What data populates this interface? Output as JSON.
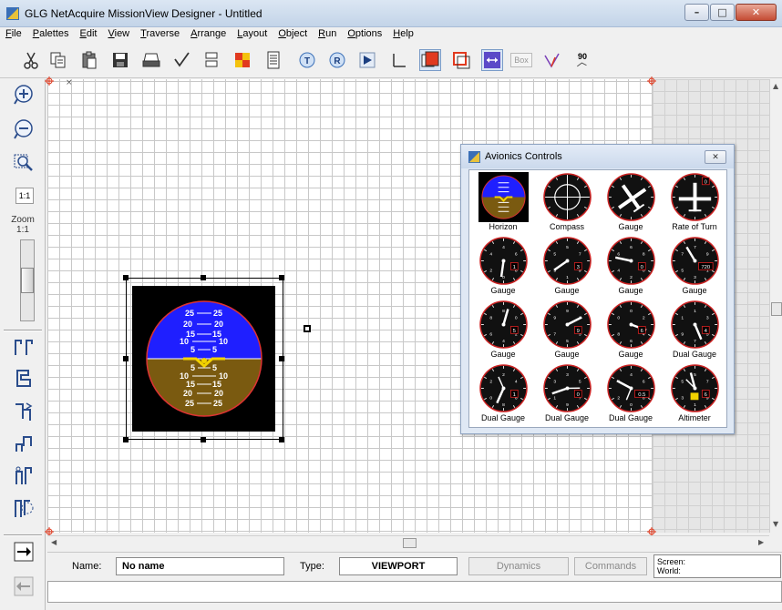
{
  "window": {
    "title": "GLG NetAcquire MissionView Designer - Untitled",
    "minimize": "–",
    "maximize": "□",
    "close": "✕"
  },
  "menu": [
    "File",
    "Palettes",
    "Edit",
    "View",
    "Traverse",
    "Arrange",
    "Layout",
    "Object",
    "Run",
    "Options",
    "Help"
  ],
  "toolbar": {
    "icons": [
      "scissors-icon",
      "copy-icon",
      "paste-icon",
      "save-icon",
      "print-icon",
      "check-arrow-icon",
      "align-icon",
      "color-palette-icon",
      "properties-icon",
      "T-circle-icon",
      "R-circle-icon",
      "play-icon",
      "antialias-icon",
      "fill-color-icon",
      "edge-color-icon",
      "flip-icon",
      "box-icon",
      "rotate-pick-icon",
      "rotate-90-icon"
    ],
    "box_label": "Box",
    "rotate_label": "90"
  },
  "left_palette": {
    "zoom_one_label": "1:1",
    "zoom_label": "Zoom",
    "zoom_value": "1:1"
  },
  "canvas": {
    "horizon_labels_top": [
      "25",
      "25",
      "20",
      "20",
      "15",
      "15",
      "10",
      "10",
      "5",
      "5"
    ],
    "horizon_labels_bottom": [
      "5",
      "5",
      "10",
      "10",
      "15",
      "15",
      "20",
      "20",
      "25",
      "25"
    ]
  },
  "avionics_dialog": {
    "title": "Avionics Controls",
    "close": "✕",
    "items": [
      {
        "label": "Horizon",
        "kind": "horizon"
      },
      {
        "label": "Compass",
        "kind": "compass"
      },
      {
        "label": "Gauge",
        "kind": "plane"
      },
      {
        "label": "Rate of Turn",
        "kind": "turn",
        "readout": "0"
      },
      {
        "label": "Gauge",
        "kind": "dial",
        "readout": "1"
      },
      {
        "label": "Gauge",
        "kind": "dial",
        "readout": "3"
      },
      {
        "label": "Gauge",
        "kind": "dial",
        "readout": "0"
      },
      {
        "label": "Gauge",
        "kind": "dial",
        "readout": "720"
      },
      {
        "label": "Gauge",
        "kind": "dial",
        "readout": "5"
      },
      {
        "label": "Gauge",
        "kind": "dial",
        "readout": "9"
      },
      {
        "label": "Gauge",
        "kind": "dial",
        "readout": "6"
      },
      {
        "label": "Dual Gauge",
        "kind": "dial",
        "readout": "4"
      },
      {
        "label": "Dual Gauge",
        "kind": "dual",
        "readout": "1"
      },
      {
        "label": "Dual Gauge",
        "kind": "dual",
        "readout": "0"
      },
      {
        "label": "Dual Gauge",
        "kind": "dual",
        "readout": "0.5"
      },
      {
        "label": "Altimeter",
        "kind": "alt",
        "readout": "6"
      }
    ]
  },
  "status": {
    "name_label": "Name:",
    "name_value": "No name",
    "type_label": "Type:",
    "type_value": "VIEWPORT",
    "dynamics_button": "Dynamics",
    "commands_button": "Commands",
    "screen_label": "Screen:",
    "world_label": "World:"
  }
}
